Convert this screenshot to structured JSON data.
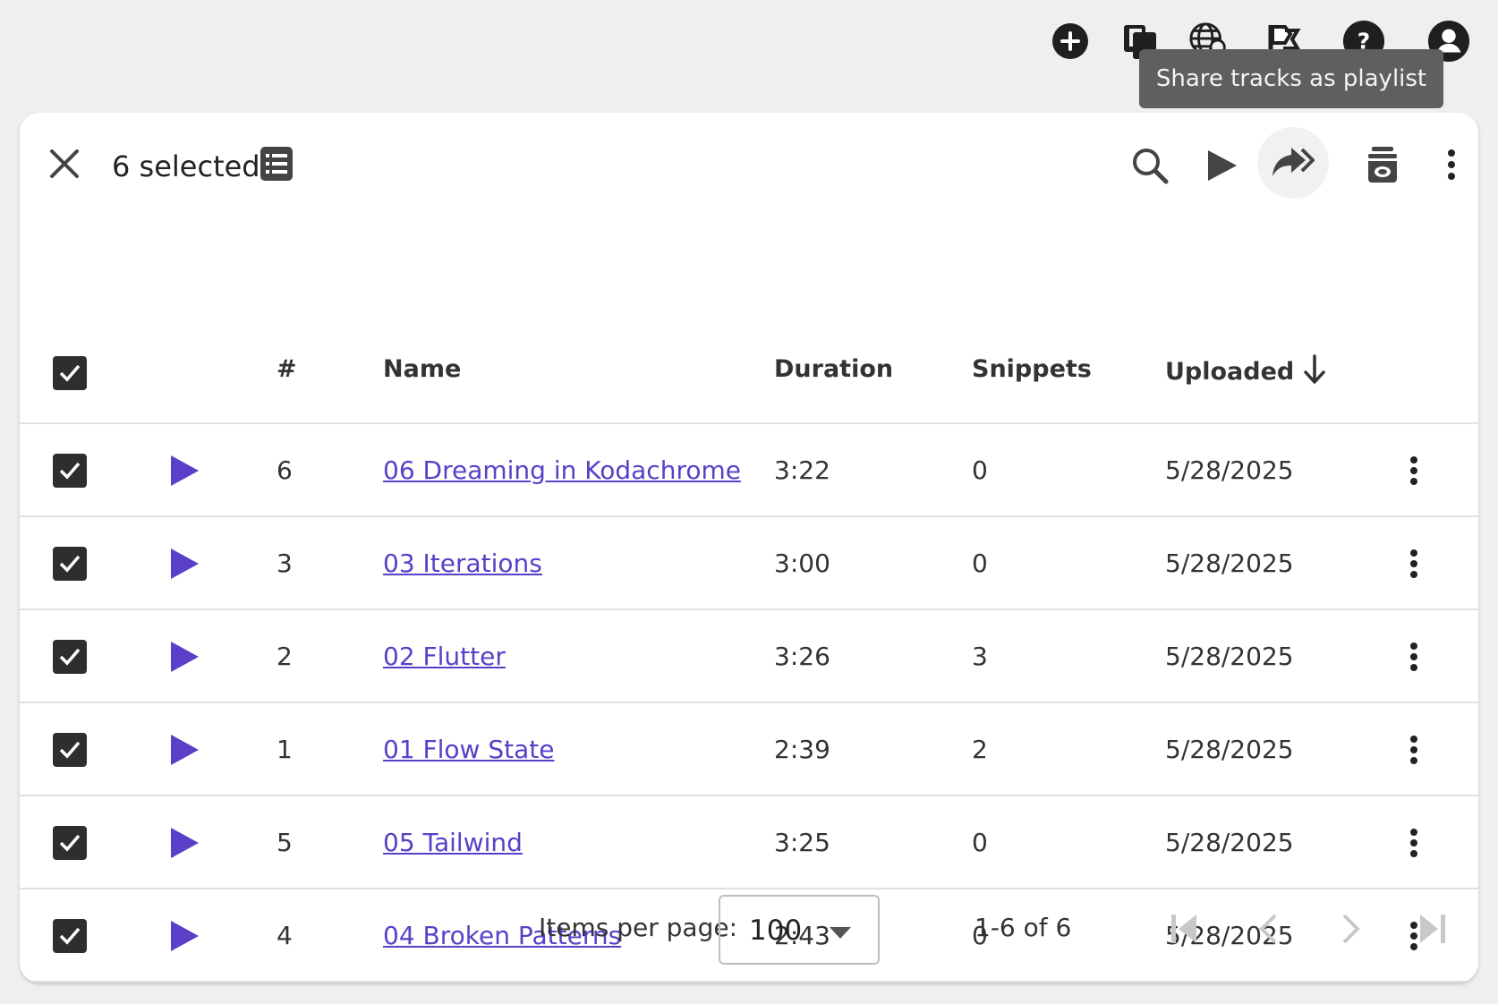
{
  "tooltip": "Share tracks as playlist",
  "selection": {
    "label": "6 selected"
  },
  "table": {
    "headers": {
      "number": "#",
      "name": "Name",
      "duration": "Duration",
      "snippets": "Snippets",
      "uploaded": "Uploaded"
    },
    "rows": [
      {
        "number": "6",
        "name": "06 Dreaming in Kodachrome",
        "duration": "3:22",
        "snippets": "0",
        "uploaded": "5/28/2025",
        "checked": true
      },
      {
        "number": "3",
        "name": "03 Iterations",
        "duration": "3:00",
        "snippets": "0",
        "uploaded": "5/28/2025",
        "checked": true
      },
      {
        "number": "2",
        "name": "02 Flutter",
        "duration": "3:26",
        "snippets": "3",
        "uploaded": "5/28/2025",
        "checked": true
      },
      {
        "number": "1",
        "name": "01 Flow State",
        "duration": "2:39",
        "snippets": "2",
        "uploaded": "5/28/2025",
        "checked": true
      },
      {
        "number": "5",
        "name": "05 Tailwind",
        "duration": "3:25",
        "snippets": "0",
        "uploaded": "5/28/2025",
        "checked": true
      },
      {
        "number": "4",
        "name": "04 Broken Patterns",
        "duration": "2:43",
        "snippets": "0",
        "uploaded": "5/28/2025",
        "checked": true
      }
    ]
  },
  "pagination": {
    "items_per_page_label": "Items per page:",
    "items_per_page_value": "100",
    "range": "1-6 of 6"
  },
  "colors": {
    "accent": "#5a3fc8",
    "dark_icon": "#2a2a2a"
  },
  "icons": {
    "top": [
      "add-circle-icon",
      "copy-files-icon",
      "globe-search-icon",
      "flag-icon",
      "help-circle-icon",
      "account-circle-icon"
    ],
    "toolbar": [
      "close-icon",
      "list-icon",
      "search-icon",
      "play-icon",
      "share-playlist-icon",
      "jar-icon",
      "more-vert-icon"
    ]
  }
}
